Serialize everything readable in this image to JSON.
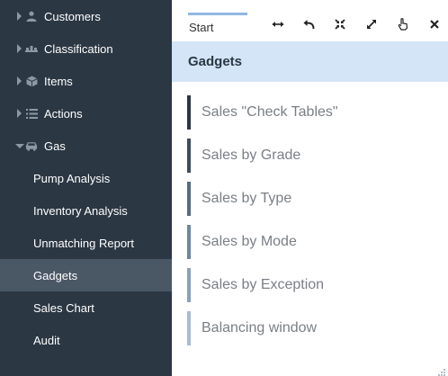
{
  "sidebar": {
    "items": [
      {
        "label": "Customers",
        "icon": "person-icon"
      },
      {
        "label": "Classification",
        "icon": "classification-icon"
      },
      {
        "label": "Items",
        "icon": "cube-icon"
      },
      {
        "label": "Actions",
        "icon": "list-icon"
      },
      {
        "label": "Gas",
        "icon": "car-icon"
      }
    ],
    "gas_children": [
      {
        "label": "Pump Analysis"
      },
      {
        "label": "Inventory Analysis"
      },
      {
        "label": "Unmatching Report"
      },
      {
        "label": "Gadgets",
        "active": true
      },
      {
        "label": "Sales Chart"
      },
      {
        "label": "Audit"
      }
    ]
  },
  "tabs": {
    "start_label": "Start"
  },
  "toolbar": {
    "icons": [
      "swap-horizontal-icon",
      "undo-icon",
      "compress-icon",
      "expand-icon",
      "hand-pointer-icon",
      "close-icon"
    ]
  },
  "main": {
    "header": "Gadgets",
    "gadgets": [
      {
        "label": "Sales \"Check Tables\"",
        "color": "#2b3743"
      },
      {
        "label": "Sales by Grade",
        "color": "#3d4d5e"
      },
      {
        "label": "Sales by Type",
        "color": "#566b80"
      },
      {
        "label": "Sales by Mode",
        "color": "#6f86a0"
      },
      {
        "label": "Sales by Exception",
        "color": "#8aa0b8"
      },
      {
        "label": "Balancing window",
        "color": "#a9bbcf"
      }
    ]
  },
  "colors": {
    "sidebar_bg": "#2b3743",
    "active_bg": "#4a5765",
    "header_bg": "#d3e5f6",
    "tab_accent": "#8fb8e0"
  }
}
